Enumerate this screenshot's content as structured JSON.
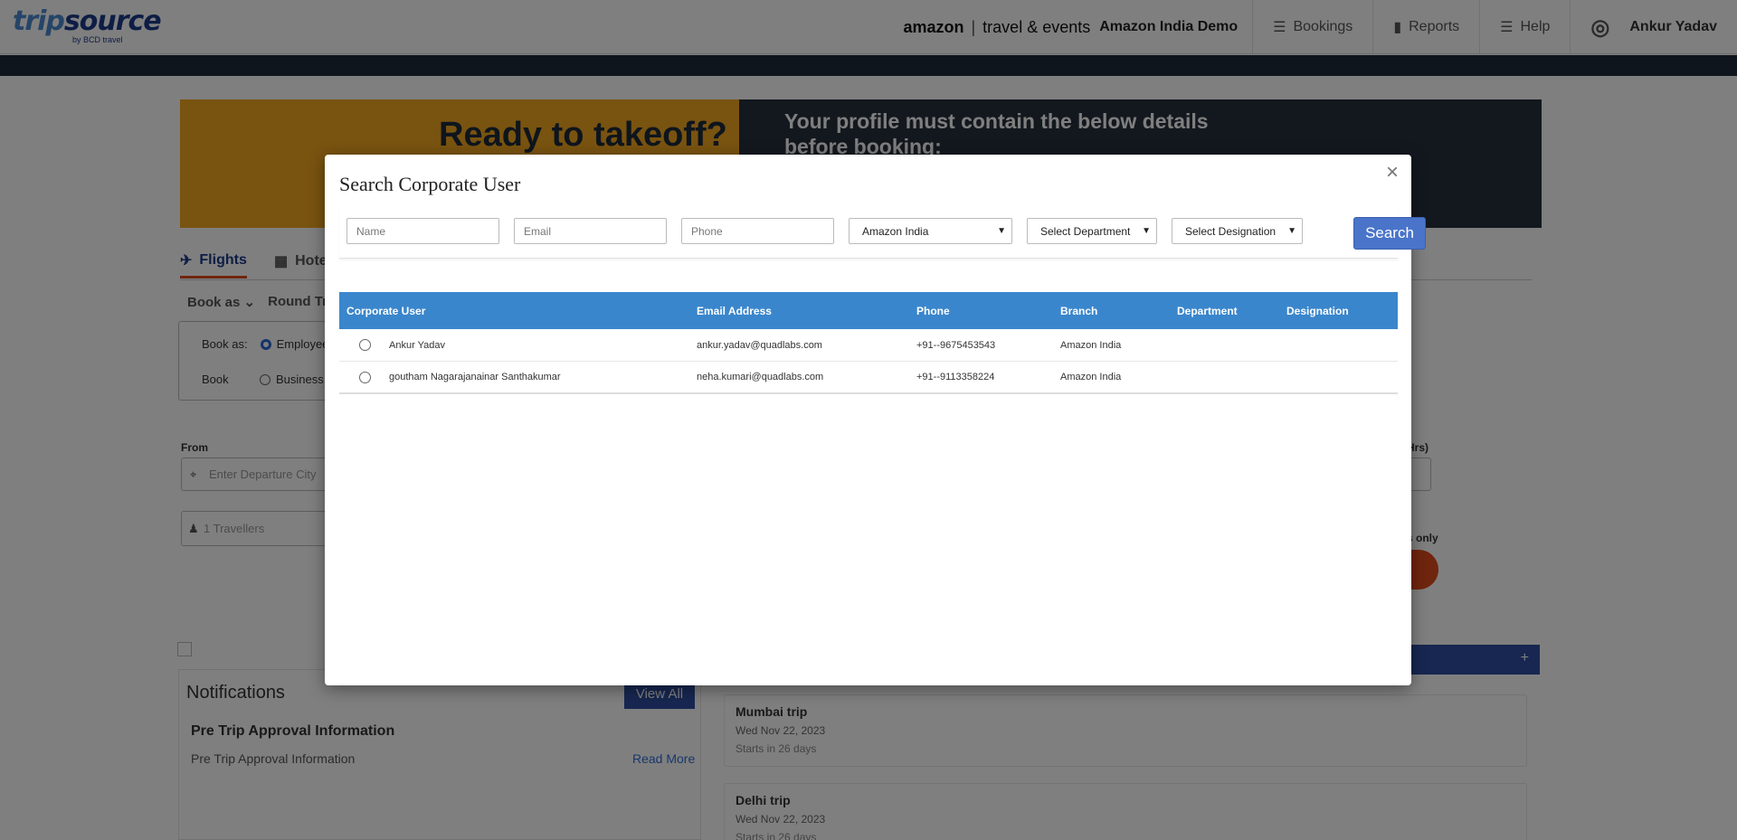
{
  "header": {
    "logo": {
      "trip": "trip",
      "source": "source",
      "sub": "by BCD travel"
    },
    "amazon_brand": "amazon",
    "amazon_suffix": "travel & events",
    "company": "Amazon India Demo",
    "nav": {
      "bookings": "Bookings",
      "reports": "Reports",
      "help": "Help",
      "user": "Ankur Yadav"
    }
  },
  "banner": {
    "left_text": "Ready to takeoff?",
    "right_text": "Your profile must contain the below details before booking:"
  },
  "tabs": {
    "flights": "Flights",
    "hotels": "Hote"
  },
  "booking_options": {
    "book_as": "Book as",
    "round_trip": "Round Tri"
  },
  "book_box": {
    "row1_label": "Book as:",
    "row1_option": "Employee",
    "row2_label": "Book",
    "row2_option": "Business"
  },
  "search_form": {
    "from_label": "From",
    "from_placeholder": "Enter Departure City",
    "travellers": "1 Travellers",
    "hrs_label": "Hrs)",
    "only_label": "s only"
  },
  "notifications": {
    "title": "Notifications",
    "view_all": "View All",
    "item_title": "Pre Trip Approval Information",
    "item_text": "Pre Trip Approval Information",
    "read_more": "Read More"
  },
  "trips": {
    "plus": "+",
    "items": [
      {
        "name": "Mumbai trip",
        "date": "Wed Nov 22, 2023",
        "starts": "Starts in 26 days"
      },
      {
        "name": "Delhi trip",
        "date": "Wed Nov 22, 2023",
        "starts": "Starts in 26 days"
      }
    ]
  },
  "modal": {
    "title": "Search Corporate User",
    "close": "×",
    "filters": {
      "name_placeholder": "Name",
      "email_placeholder": "Email",
      "phone_placeholder": "Phone",
      "branch_selected": "Amazon India",
      "department_selected": "Select Department",
      "designation_selected": "Select Designation",
      "search_label": "Search"
    },
    "table": {
      "columns": [
        "Corporate User",
        "Email Address",
        "Phone",
        "Branch",
        "Department",
        "Designation"
      ],
      "rows": [
        {
          "name": "Ankur Yadav",
          "email": "ankur.yadav@quadlabs.com",
          "phone": "+91--9675453543",
          "branch": "Amazon India",
          "department": "",
          "designation": ""
        },
        {
          "name": "goutham Nagarajanainar Santhakumar",
          "email": "neha.kumari@quadlabs.com",
          "phone": "+91--9113358224",
          "branch": "Amazon India",
          "department": "",
          "designation": ""
        }
      ]
    }
  },
  "colors": {
    "primary_blue": "#2f4fa2",
    "table_header": "#3a86cc",
    "search_button": "#4a74c9",
    "accent_orange": "#e04a1c",
    "banner_yellow": "#f3a620",
    "banner_dark": "#26303e"
  },
  "icons": {
    "bookings": "list-icon",
    "reports": "bar-chart-icon",
    "help": "menu-icon",
    "user": "user-circle-icon",
    "flight": "plane-icon",
    "hotel": "building-icon",
    "location": "map-pin-icon",
    "traveller": "person-icon",
    "close": "close-icon",
    "dropdown": "chevron-down-icon"
  }
}
